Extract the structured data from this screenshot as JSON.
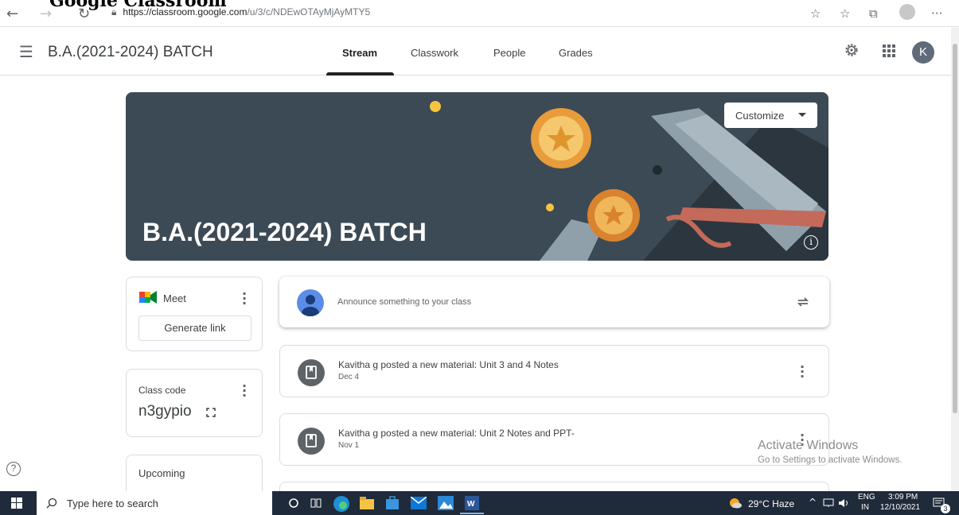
{
  "overlay": {
    "title": "Google Classroom"
  },
  "browser": {
    "url_host": "https://classroom.google.com",
    "url_path": "/u/3/c/NDEwOTAyMjAyMTY5"
  },
  "header": {
    "title": "B.A.(2021-2024) BATCH",
    "tabs": [
      {
        "label": "Stream",
        "active": true
      },
      {
        "label": "Classwork",
        "active": false
      },
      {
        "label": "People",
        "active": false
      },
      {
        "label": "Grades",
        "active": false
      }
    ],
    "avatar_letter": "K"
  },
  "banner": {
    "title": "B.A.(2021-2024) BATCH",
    "customize_label": "Customize",
    "info_glyph": "i"
  },
  "meet": {
    "label": "Meet",
    "generate_label": "Generate link"
  },
  "class_code": {
    "label": "Class code",
    "value": "n3gypio"
  },
  "upcoming": {
    "label": "Upcoming"
  },
  "stream": {
    "announce_placeholder": "Announce something to your class",
    "posts": [
      {
        "title": "Kavitha g posted a new material: Unit 3 and 4 Notes",
        "date": "Dec 4"
      },
      {
        "title": "Kavitha g posted a new material: Unit 2 Notes and PPT-",
        "date": "Nov 1"
      }
    ]
  },
  "help_glyph": "?",
  "watermark": {
    "title": "Activate Windows",
    "subtitle": "Go to Settings to activate Windows."
  },
  "taskbar": {
    "search_placeholder": "Type here to search",
    "weather": "29°C  Haze",
    "lang_top": "ENG",
    "lang_bottom": "IN",
    "time": "3:09 PM",
    "date": "12/10/2021",
    "notification_count": "3"
  },
  "colors": {
    "accent": "#1a73e8",
    "banner": "#3c4a55",
    "taskbar": "#1f2a3a"
  },
  "icons": [
    "back-icon",
    "forward-icon",
    "refresh-icon",
    "lock-icon",
    "hamburger-icon",
    "settings-icon",
    "apps-grid-icon",
    "meet-icon",
    "fullscreen-icon",
    "repost-icon",
    "material-icon",
    "help-icon",
    "windows-start-icon",
    "search-icon"
  ]
}
